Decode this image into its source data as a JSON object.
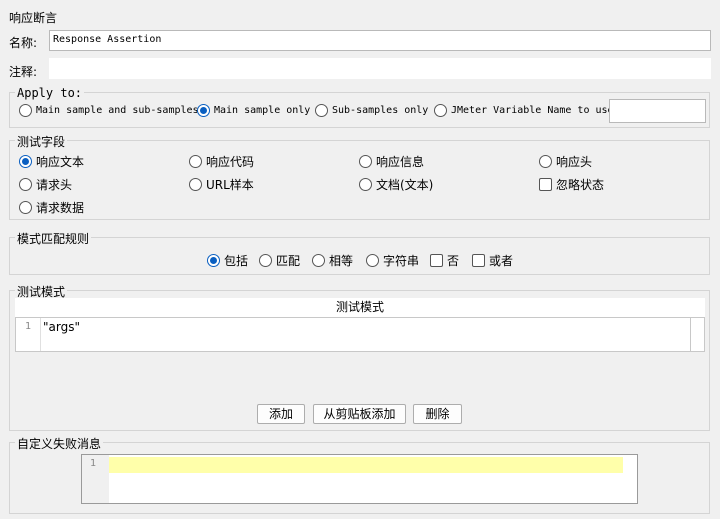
{
  "page": {
    "title": "响应断言"
  },
  "name_field": {
    "label": "名称:",
    "value": "Response Assertion"
  },
  "comment_field": {
    "label": "注释:",
    "value": ""
  },
  "apply_to": {
    "legend": "Apply to:",
    "options": [
      {
        "label": "Main sample and sub-samples",
        "selected": false
      },
      {
        "label": "Main sample only",
        "selected": true
      },
      {
        "label": "Sub-samples only",
        "selected": false
      },
      {
        "label": "JMeter Variable Name to use",
        "selected": false
      }
    ],
    "variable_name": ""
  },
  "test_field": {
    "legend": "测试字段",
    "options": {
      "response_text": {
        "label": "响应文本",
        "selected": true
      },
      "response_code": {
        "label": "响应代码",
        "selected": false
      },
      "response_message": {
        "label": "响应信息",
        "selected": false
      },
      "response_headers": {
        "label": "响应头",
        "selected": false
      },
      "request_headers": {
        "label": "请求头",
        "selected": false
      },
      "url_sample": {
        "label": "URL样本",
        "selected": false
      },
      "document_text": {
        "label": "文档(文本)",
        "selected": false
      },
      "ignore_status": {
        "label": "忽略状态",
        "checked": false
      },
      "request_data": {
        "label": "请求数据",
        "selected": false
      }
    }
  },
  "pattern_matching": {
    "legend": "模式匹配规则",
    "contains": {
      "label": "包括",
      "selected": true
    },
    "matches": {
      "label": "匹配",
      "selected": false
    },
    "equals": {
      "label": "相等",
      "selected": false
    },
    "substring": {
      "label": "字符串",
      "selected": false
    },
    "not": {
      "label": "否",
      "checked": false
    },
    "or": {
      "label": "或者",
      "checked": false
    }
  },
  "patterns": {
    "legend": "测试模式",
    "column_header": "测试模式",
    "rows": [
      {
        "line": "1",
        "text": "\"args\""
      }
    ],
    "buttons": {
      "add": "添加",
      "add_from_clipboard": "从剪贴板添加",
      "delete": "删除"
    }
  },
  "custom_failure": {
    "legend": "自定义失败消息",
    "line": "1",
    "text": ""
  },
  "colors": {
    "accent": "#0a5fc1",
    "highlight_line": "#ffffaa"
  }
}
